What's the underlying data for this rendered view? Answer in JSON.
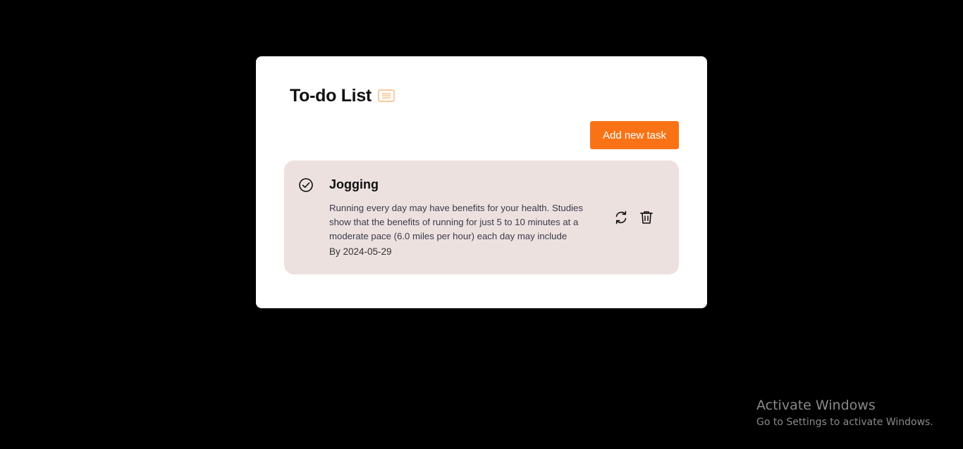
{
  "colors": {
    "background": "#000000",
    "card": "#ffffff",
    "accent": "#f97316",
    "accent_light": "#f5b67a",
    "task_bg": "#ede1df"
  },
  "header": {
    "title": "To-do List",
    "icon": "list-icon"
  },
  "toolbar": {
    "add_label": "Add new task"
  },
  "tasks": [
    {
      "title": "Jogging",
      "description": "Running every day may have benefits for your health. Studies show that the benefits of running for just 5 to 10 minutes at a moderate pace (6.0 miles per hour) each day may include",
      "due": "By 2024-05-29",
      "status_icon": "check-circle-icon",
      "actions": [
        "refresh-icon",
        "trash-icon"
      ]
    }
  ],
  "watermark": {
    "title": "Activate Windows",
    "subtitle": "Go to Settings to activate Windows."
  }
}
